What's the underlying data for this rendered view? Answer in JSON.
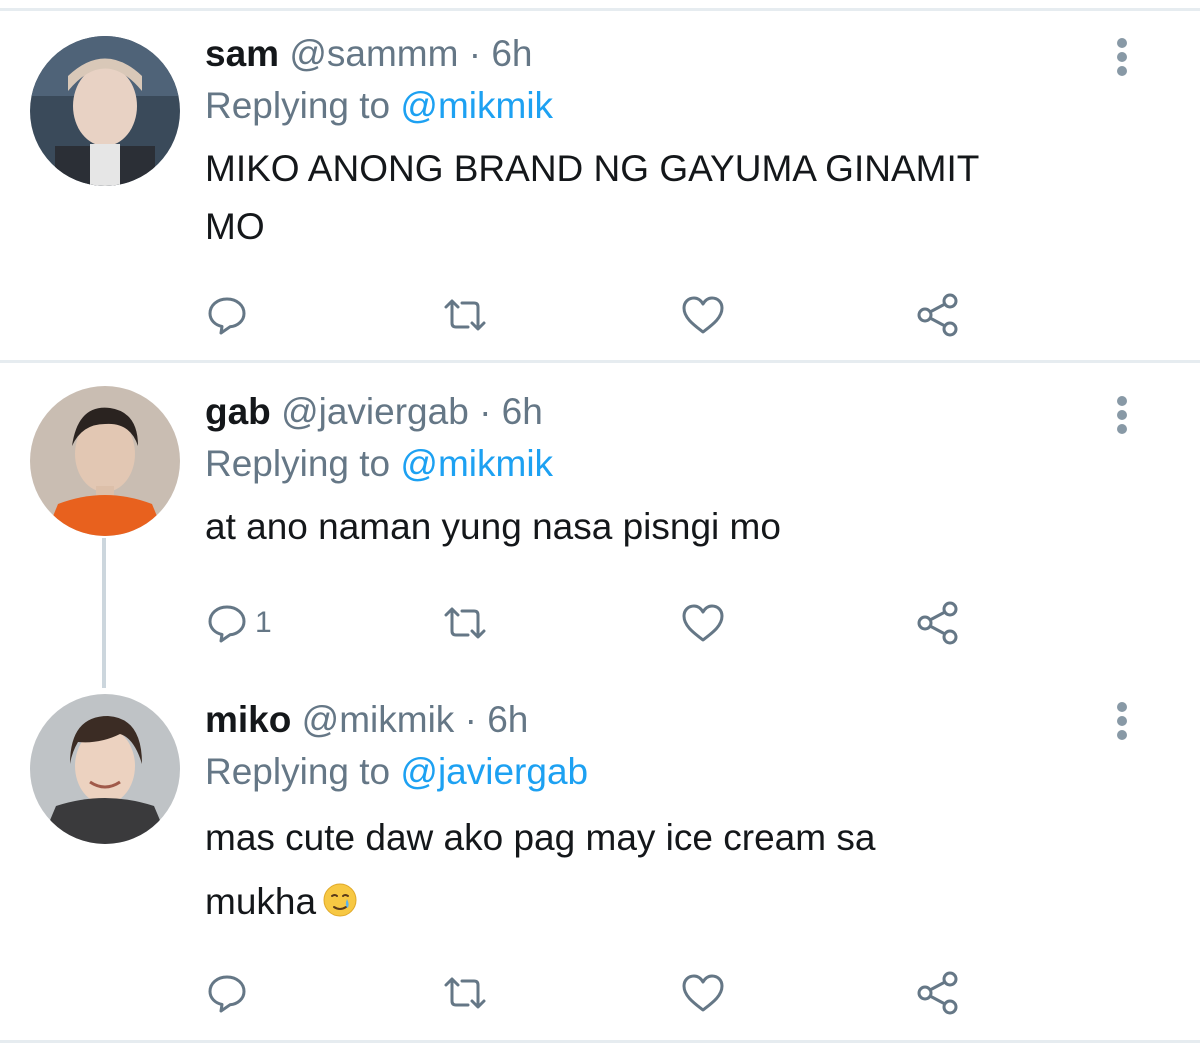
{
  "tweets": [
    {
      "name": "sam",
      "handle": "@sammm",
      "separator": "·",
      "time": "6h",
      "replying_prefix": "Replying to",
      "replying_to": "@mikmik",
      "text_line1": "MIKO ANONG BRAND NG GAYUMA GINAMIT",
      "text_line2": "MO",
      "reply_count": ""
    },
    {
      "name": "gab",
      "handle": "@javiergab",
      "separator": "·",
      "time": "6h",
      "replying_prefix": "Replying to",
      "replying_to": "@mikmik",
      "text_line1": "at ano naman yung nasa pisngi mo",
      "reply_count": "1"
    },
    {
      "name": "miko",
      "handle": "@mikmik",
      "separator": "·",
      "time": "6h",
      "replying_prefix": "Replying to",
      "replying_to": "@javiergab",
      "text_line1": "mas cute daw ako pag may ice cream sa",
      "text_line2": "mukha",
      "emoji": "crying-face-smile-emoji",
      "reply_count": ""
    }
  ],
  "colors": {
    "link": "#1da1f2",
    "secondary": "#657786",
    "icon": "#657786",
    "divider": "#e6ecf0",
    "thread_line": "#ccd6dd"
  },
  "icons": [
    "reply-icon",
    "retweet-icon",
    "like-icon",
    "share-icon",
    "more-options-icon"
  ]
}
